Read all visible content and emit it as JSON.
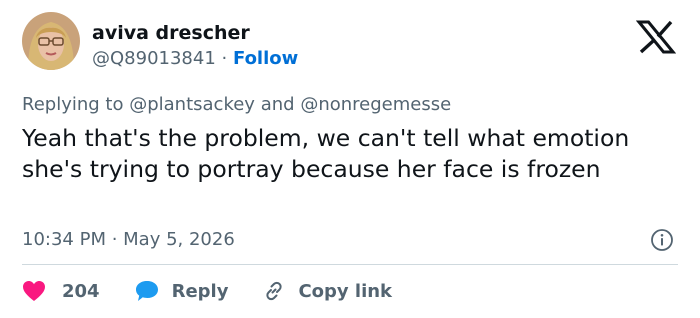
{
  "author": {
    "name": "aviva drescher",
    "handle": "@Q89013841",
    "separator": "·",
    "follow_label": "Follow"
  },
  "reply_context": {
    "prefix": "Replying to",
    "mention_1": "@plantsackey",
    "conjunction": "and",
    "mention_2": "@nonregemesse"
  },
  "tweet": {
    "text": "Yeah that's the problem, we can't tell what emotion she's trying to portray because her face is frozen",
    "timestamp": "10:34 PM · May 5, 2026"
  },
  "actions": {
    "like_count": "204",
    "reply_label": "Reply",
    "copy_link_label": "Copy link"
  },
  "icons": {
    "logo": "x-logo-icon",
    "info": "info-icon",
    "like": "heart-icon",
    "reply": "speech-bubble-icon",
    "copy": "link-icon"
  },
  "colors": {
    "text": "#0f1419",
    "secondary": "#536471",
    "link": "#006fd6",
    "like": "#f91880",
    "reply": "#1d9bf0",
    "divider": "#cfd9de"
  }
}
